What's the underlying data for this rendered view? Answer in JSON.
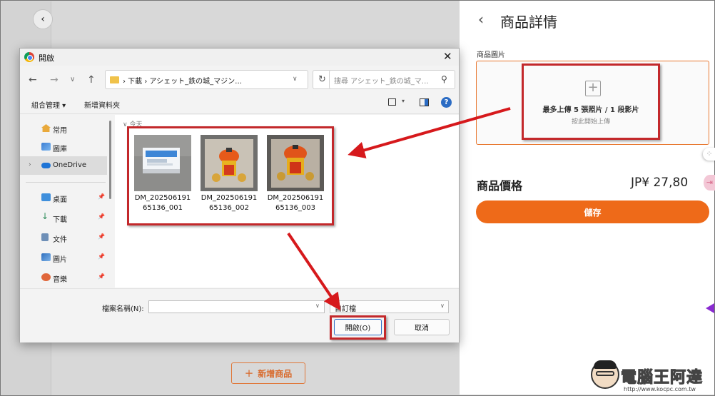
{
  "background": {
    "back_icon": "‹",
    "add_product_plus": "+",
    "add_product_label": "新增商品"
  },
  "right_panel": {
    "back_icon": "‹",
    "title": "商品詳情",
    "image_label": "商品圖片",
    "upload_icon": "+",
    "upload_main": "最多上傳 5 張照片 / 1 段影片",
    "upload_sub": "按此開始上傳",
    "price_label": "商品價格",
    "price_value": "JP¥ 27,80",
    "save_label": "儲存",
    "accent_color": "#ee6a19"
  },
  "dialog": {
    "title": "開啟",
    "close_icon": "✕",
    "nav": {
      "back_icon": "←",
      "forward_icon": "→",
      "recent_icon": "∨",
      "up_icon": "↑"
    },
    "address": "›  下載  ›  アシェット_鉄の城_マジン…",
    "address_chevron": "∨",
    "refresh_icon": "↻",
    "search_placeholder": "搜尋 アシェット_鉄の城_マ…",
    "search_icon": "⚲",
    "toolbar": {
      "organize": "組合管理 ▾",
      "new_folder": "新增資料夾",
      "view_dropdown": "▾",
      "help": "?"
    },
    "sidebar": {
      "items": [
        {
          "label": "常用",
          "icon": "home-icon"
        },
        {
          "label": "圖庫",
          "icon": "gallery-icon"
        },
        {
          "label": "OneDrive",
          "icon": "cloud-icon",
          "chevron": "›"
        },
        {
          "label": "桌面",
          "icon": "desktop-icon",
          "pin": "📌"
        },
        {
          "label": "下載",
          "icon": "download-icon",
          "pin": "📌"
        },
        {
          "label": "文件",
          "icon": "document-icon",
          "pin": "📌"
        },
        {
          "label": "圖片",
          "icon": "picture-icon",
          "pin": "📌"
        },
        {
          "label": "音樂",
          "icon": "music-icon",
          "pin": "📌"
        }
      ]
    },
    "files_group": "∨  今天",
    "files": [
      {
        "name": "DM_20250619165136_001",
        "line1": "DM_202506191",
        "line2": "65136_001"
      },
      {
        "name": "DM_20250619165136_002",
        "line1": "DM_202506191",
        "line2": "65136_002"
      },
      {
        "name": "DM_20250619165136_003",
        "line1": "DM_202506191",
        "line2": "65136_003"
      }
    ],
    "filename_label": "檔案名稱(N):",
    "filename_value": "",
    "filename_chevron": "∨",
    "filetype_label": "自訂檔",
    "filetype_chevron": "∨",
    "open_button": "開啟(O)",
    "cancel_button": "取消"
  },
  "watermark": {
    "text": "電腦王阿達",
    "url": "http://www.kocpc.com.tw"
  },
  "annotation_color": "#d6191c"
}
